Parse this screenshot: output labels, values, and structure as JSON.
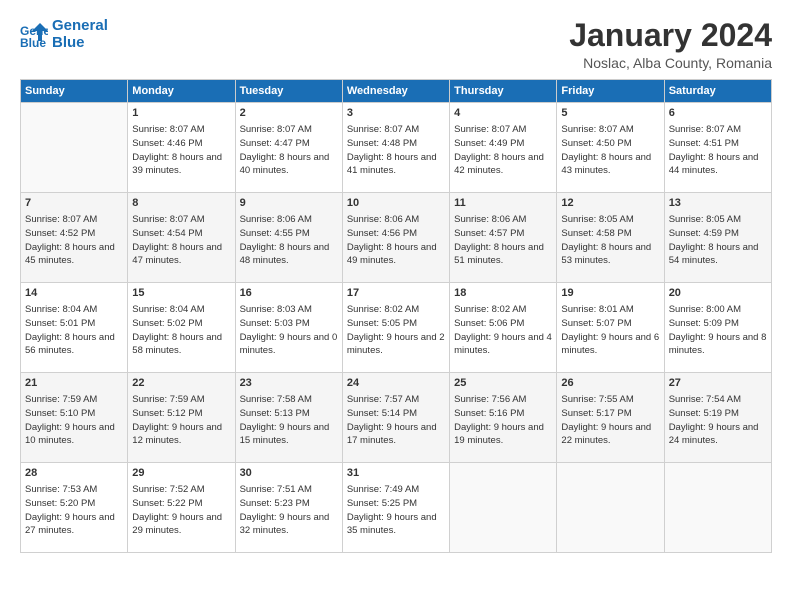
{
  "header": {
    "logo_line1": "General",
    "logo_line2": "Blue",
    "title": "January 2024",
    "subtitle": "Noslac, Alba County, Romania"
  },
  "weekdays": [
    "Sunday",
    "Monday",
    "Tuesday",
    "Wednesday",
    "Thursday",
    "Friday",
    "Saturday"
  ],
  "weeks": [
    [
      {
        "day": "",
        "empty": true
      },
      {
        "day": "1",
        "sunrise": "Sunrise: 8:07 AM",
        "sunset": "Sunset: 4:46 PM",
        "daylight": "Daylight: 8 hours and 39 minutes."
      },
      {
        "day": "2",
        "sunrise": "Sunrise: 8:07 AM",
        "sunset": "Sunset: 4:47 PM",
        "daylight": "Daylight: 8 hours and 40 minutes."
      },
      {
        "day": "3",
        "sunrise": "Sunrise: 8:07 AM",
        "sunset": "Sunset: 4:48 PM",
        "daylight": "Daylight: 8 hours and 41 minutes."
      },
      {
        "day": "4",
        "sunrise": "Sunrise: 8:07 AM",
        "sunset": "Sunset: 4:49 PM",
        "daylight": "Daylight: 8 hours and 42 minutes."
      },
      {
        "day": "5",
        "sunrise": "Sunrise: 8:07 AM",
        "sunset": "Sunset: 4:50 PM",
        "daylight": "Daylight: 8 hours and 43 minutes."
      },
      {
        "day": "6",
        "sunrise": "Sunrise: 8:07 AM",
        "sunset": "Sunset: 4:51 PM",
        "daylight": "Daylight: 8 hours and 44 minutes."
      }
    ],
    [
      {
        "day": "7",
        "sunrise": "Sunrise: 8:07 AM",
        "sunset": "Sunset: 4:52 PM",
        "daylight": "Daylight: 8 hours and 45 minutes."
      },
      {
        "day": "8",
        "sunrise": "Sunrise: 8:07 AM",
        "sunset": "Sunset: 4:54 PM",
        "daylight": "Daylight: 8 hours and 47 minutes."
      },
      {
        "day": "9",
        "sunrise": "Sunrise: 8:06 AM",
        "sunset": "Sunset: 4:55 PM",
        "daylight": "Daylight: 8 hours and 48 minutes."
      },
      {
        "day": "10",
        "sunrise": "Sunrise: 8:06 AM",
        "sunset": "Sunset: 4:56 PM",
        "daylight": "Daylight: 8 hours and 49 minutes."
      },
      {
        "day": "11",
        "sunrise": "Sunrise: 8:06 AM",
        "sunset": "Sunset: 4:57 PM",
        "daylight": "Daylight: 8 hours and 51 minutes."
      },
      {
        "day": "12",
        "sunrise": "Sunrise: 8:05 AM",
        "sunset": "Sunset: 4:58 PM",
        "daylight": "Daylight: 8 hours and 53 minutes."
      },
      {
        "day": "13",
        "sunrise": "Sunrise: 8:05 AM",
        "sunset": "Sunset: 4:59 PM",
        "daylight": "Daylight: 8 hours and 54 minutes."
      }
    ],
    [
      {
        "day": "14",
        "sunrise": "Sunrise: 8:04 AM",
        "sunset": "Sunset: 5:01 PM",
        "daylight": "Daylight: 8 hours and 56 minutes."
      },
      {
        "day": "15",
        "sunrise": "Sunrise: 8:04 AM",
        "sunset": "Sunset: 5:02 PM",
        "daylight": "Daylight: 8 hours and 58 minutes."
      },
      {
        "day": "16",
        "sunrise": "Sunrise: 8:03 AM",
        "sunset": "Sunset: 5:03 PM",
        "daylight": "Daylight: 9 hours and 0 minutes."
      },
      {
        "day": "17",
        "sunrise": "Sunrise: 8:02 AM",
        "sunset": "Sunset: 5:05 PM",
        "daylight": "Daylight: 9 hours and 2 minutes."
      },
      {
        "day": "18",
        "sunrise": "Sunrise: 8:02 AM",
        "sunset": "Sunset: 5:06 PM",
        "daylight": "Daylight: 9 hours and 4 minutes."
      },
      {
        "day": "19",
        "sunrise": "Sunrise: 8:01 AM",
        "sunset": "Sunset: 5:07 PM",
        "daylight": "Daylight: 9 hours and 6 minutes."
      },
      {
        "day": "20",
        "sunrise": "Sunrise: 8:00 AM",
        "sunset": "Sunset: 5:09 PM",
        "daylight": "Daylight: 9 hours and 8 minutes."
      }
    ],
    [
      {
        "day": "21",
        "sunrise": "Sunrise: 7:59 AM",
        "sunset": "Sunset: 5:10 PM",
        "daylight": "Daylight: 9 hours and 10 minutes."
      },
      {
        "day": "22",
        "sunrise": "Sunrise: 7:59 AM",
        "sunset": "Sunset: 5:12 PM",
        "daylight": "Daylight: 9 hours and 12 minutes."
      },
      {
        "day": "23",
        "sunrise": "Sunrise: 7:58 AM",
        "sunset": "Sunset: 5:13 PM",
        "daylight": "Daylight: 9 hours and 15 minutes."
      },
      {
        "day": "24",
        "sunrise": "Sunrise: 7:57 AM",
        "sunset": "Sunset: 5:14 PM",
        "daylight": "Daylight: 9 hours and 17 minutes."
      },
      {
        "day": "25",
        "sunrise": "Sunrise: 7:56 AM",
        "sunset": "Sunset: 5:16 PM",
        "daylight": "Daylight: 9 hours and 19 minutes."
      },
      {
        "day": "26",
        "sunrise": "Sunrise: 7:55 AM",
        "sunset": "Sunset: 5:17 PM",
        "daylight": "Daylight: 9 hours and 22 minutes."
      },
      {
        "day": "27",
        "sunrise": "Sunrise: 7:54 AM",
        "sunset": "Sunset: 5:19 PM",
        "daylight": "Daylight: 9 hours and 24 minutes."
      }
    ],
    [
      {
        "day": "28",
        "sunrise": "Sunrise: 7:53 AM",
        "sunset": "Sunset: 5:20 PM",
        "daylight": "Daylight: 9 hours and 27 minutes."
      },
      {
        "day": "29",
        "sunrise": "Sunrise: 7:52 AM",
        "sunset": "Sunset: 5:22 PM",
        "daylight": "Daylight: 9 hours and 29 minutes."
      },
      {
        "day": "30",
        "sunrise": "Sunrise: 7:51 AM",
        "sunset": "Sunset: 5:23 PM",
        "daylight": "Daylight: 9 hours and 32 minutes."
      },
      {
        "day": "31",
        "sunrise": "Sunrise: 7:49 AM",
        "sunset": "Sunset: 5:25 PM",
        "daylight": "Daylight: 9 hours and 35 minutes."
      },
      {
        "day": "",
        "empty": true
      },
      {
        "day": "",
        "empty": true
      },
      {
        "day": "",
        "empty": true
      }
    ]
  ]
}
